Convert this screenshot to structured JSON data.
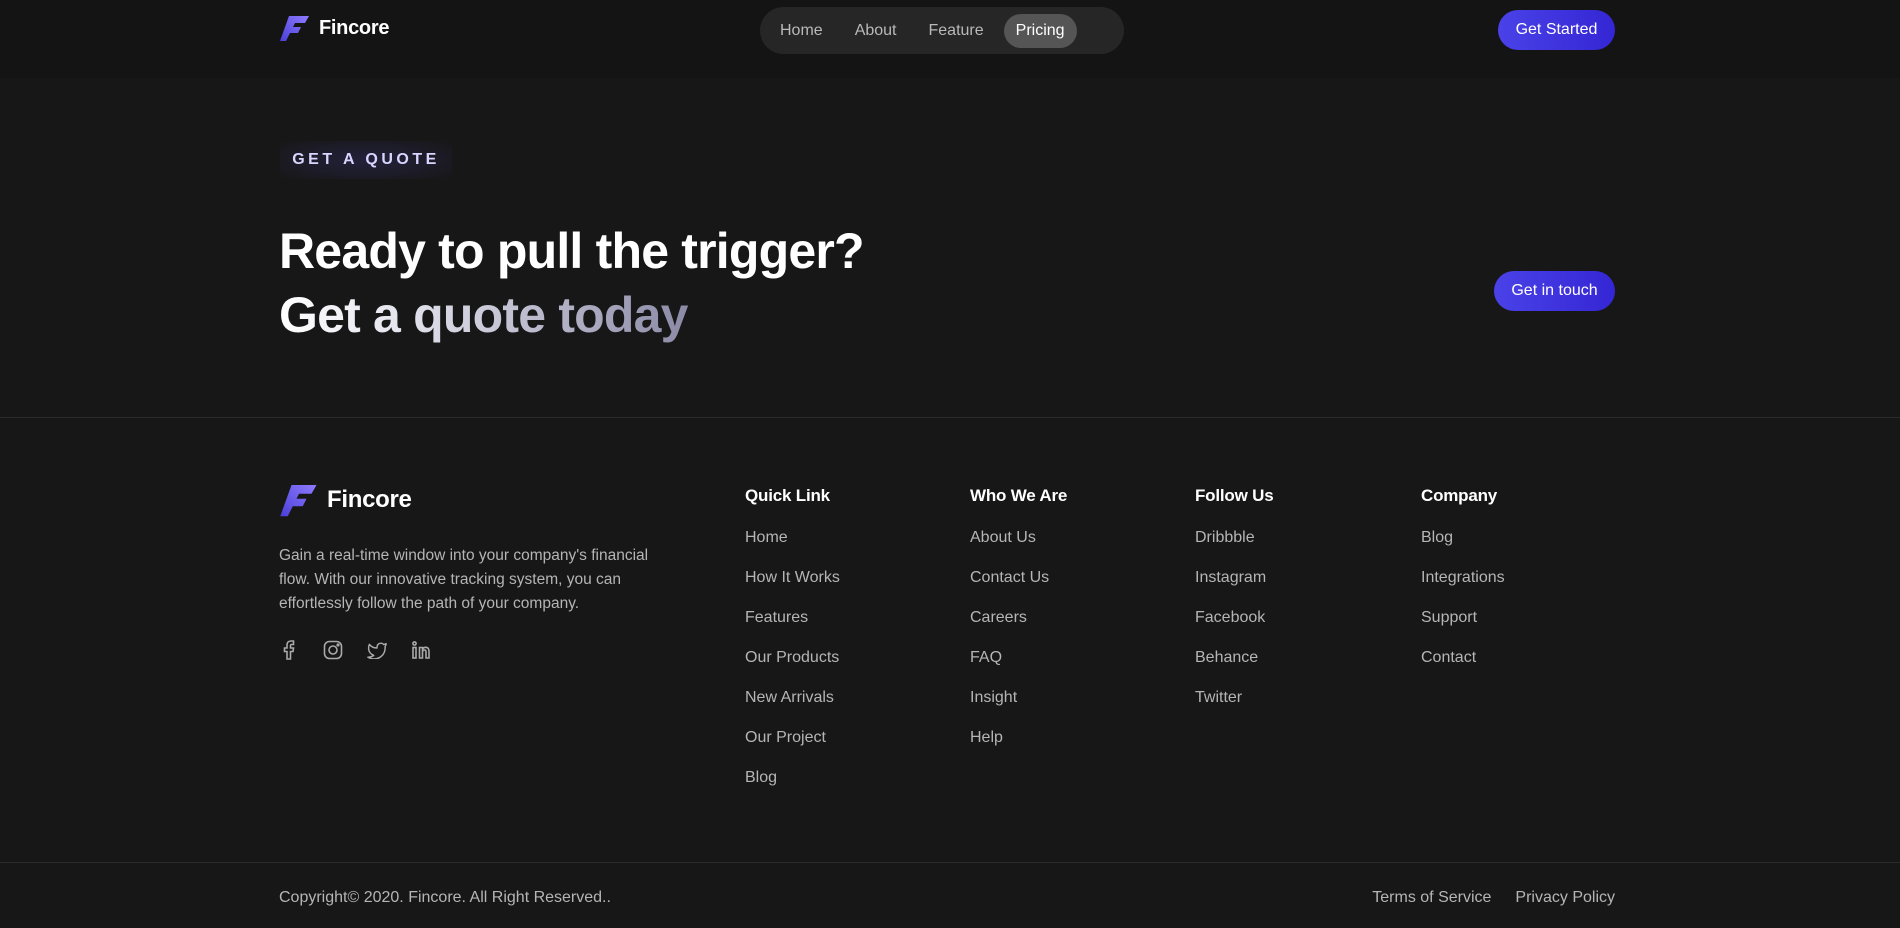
{
  "brand": {
    "name": "Fincore"
  },
  "header": {
    "nav": [
      "Home",
      "About",
      "Feature",
      "Pricing"
    ],
    "active_nav": "Pricing",
    "cta": "Get Started"
  },
  "quote": {
    "tag": "GET A QUOTE",
    "headline": "Ready to pull the trigger?",
    "subheadline": "Get a quote today",
    "cta": "Get in touch"
  },
  "footer": {
    "description": "Gain a real-time window into your company's financial flow. With our innovative tracking system, you can effortlessly follow the path of your company.",
    "socials": [
      "facebook-icon",
      "instagram-icon",
      "twitter-icon",
      "linkedin-icon"
    ],
    "columns": [
      {
        "title": "Quick Link",
        "links": [
          "Home",
          "How It Works",
          "Features",
          "Our Products",
          "New Arrivals",
          "Our Project",
          "Blog"
        ]
      },
      {
        "title": "Who We Are",
        "links": [
          "About Us",
          "Contact Us",
          "Careers",
          "FAQ",
          "Insight",
          "Help"
        ]
      },
      {
        "title": "Follow Us",
        "links": [
          "Dribbble",
          "Instagram",
          "Facebook",
          "Behance",
          "Twitter"
        ]
      },
      {
        "title": "Company",
        "links": [
          "Blog",
          "Integrations",
          "Support",
          "Contact"
        ]
      }
    ],
    "copyright": "Copyright© 2020. Fincore. All Right Reserved..",
    "legal": [
      "Terms of Service",
      "Privacy Policy"
    ]
  },
  "colors": {
    "background": "#171717",
    "header_bg": "#141414",
    "accent": "#4a42e8",
    "muted_text": "#b5b5b5"
  }
}
